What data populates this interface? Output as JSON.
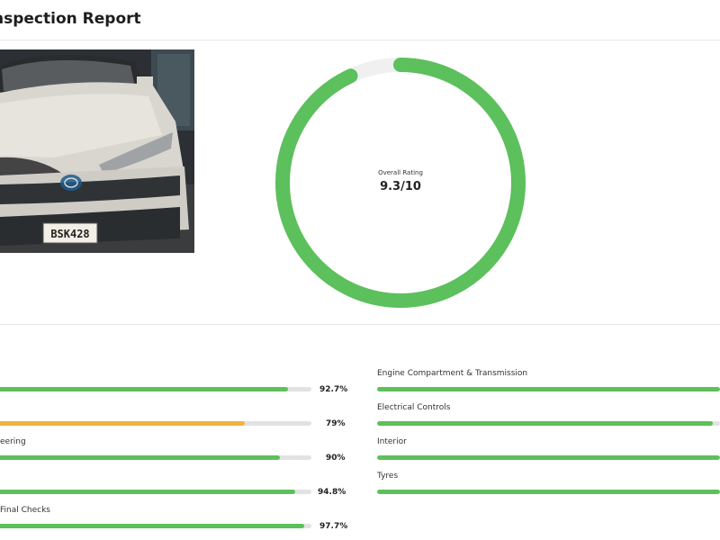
{
  "header": {
    "title": "nspection Report"
  },
  "car": {
    "plate": "BSK428",
    "image_desc": "Front view of a white Toyota SUV parked in a garage"
  },
  "gauge": {
    "label": "Overall Rating",
    "value": "9.3/10",
    "fraction": 0.93,
    "color": "#5cc05c",
    "track_color": "#f0f0f0"
  },
  "left_metrics": [
    {
      "label": "",
      "value": "92.7%",
      "fraction": 0.927,
      "color": "#5cc05c"
    },
    {
      "label": "",
      "value": "79%",
      "fraction": 0.79,
      "color": "#f2b23c"
    },
    {
      "label": "eering",
      "value": "90%",
      "fraction": 0.9,
      "color": "#5cc05c"
    },
    {
      "label": "",
      "value": "94.8%",
      "fraction": 0.948,
      "color": "#5cc05c"
    },
    {
      "label": "Final Checks",
      "value": "97.7%",
      "fraction": 0.977,
      "color": "#5cc05c"
    }
  ],
  "right_metrics": [
    {
      "label": "Engine Compartment & Transmission",
      "fraction": 1.0,
      "color": "#5cc05c"
    },
    {
      "label": "Electrical Controls",
      "fraction": 0.98,
      "color": "#5cc05c"
    },
    {
      "label": "Interior",
      "fraction": 1.0,
      "color": "#5cc05c"
    },
    {
      "label": "Tyres",
      "fraction": 1.0,
      "color": "#5cc05c"
    }
  ]
}
